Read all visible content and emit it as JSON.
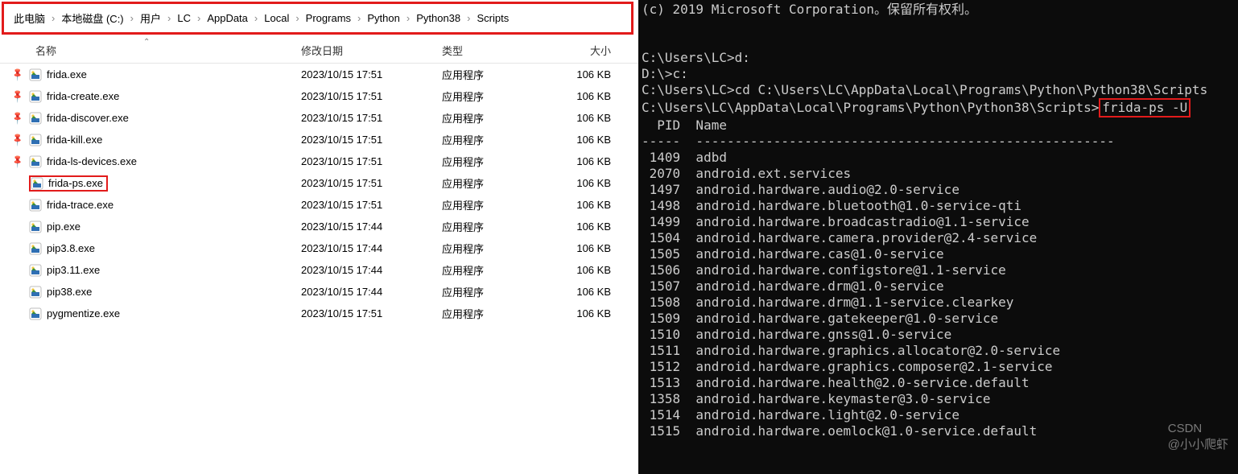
{
  "breadcrumb": [
    "此电脑",
    "本地磁盘 (C:)",
    "用户",
    "LC",
    "AppData",
    "Local",
    "Programs",
    "Python",
    "Python38",
    "Scripts"
  ],
  "columns": {
    "name": "名称",
    "date": "修改日期",
    "type": "类型",
    "size": "大小"
  },
  "files": [
    {
      "pin": true,
      "name": "frida.exe",
      "date": "2023/10/15 17:51",
      "type": "应用程序",
      "size": "106 KB",
      "hl": false
    },
    {
      "pin": true,
      "name": "frida-create.exe",
      "date": "2023/10/15 17:51",
      "type": "应用程序",
      "size": "106 KB",
      "hl": false
    },
    {
      "pin": true,
      "name": "frida-discover.exe",
      "date": "2023/10/15 17:51",
      "type": "应用程序",
      "size": "106 KB",
      "hl": false
    },
    {
      "pin": true,
      "name": "frida-kill.exe",
      "date": "2023/10/15 17:51",
      "type": "应用程序",
      "size": "106 KB",
      "hl": false
    },
    {
      "pin": true,
      "name": "frida-ls-devices.exe",
      "date": "2023/10/15 17:51",
      "type": "应用程序",
      "size": "106 KB",
      "hl": false
    },
    {
      "pin": false,
      "name": "frida-ps.exe",
      "date": "2023/10/15 17:51",
      "type": "应用程序",
      "size": "106 KB",
      "hl": true
    },
    {
      "pin": false,
      "name": "frida-trace.exe",
      "date": "2023/10/15 17:51",
      "type": "应用程序",
      "size": "106 KB",
      "hl": false
    },
    {
      "pin": false,
      "name": "pip.exe",
      "date": "2023/10/15 17:44",
      "type": "应用程序",
      "size": "106 KB",
      "hl": false
    },
    {
      "pin": false,
      "name": "pip3.8.exe",
      "date": "2023/10/15 17:44",
      "type": "应用程序",
      "size": "106 KB",
      "hl": false
    },
    {
      "pin": false,
      "name": "pip3.11.exe",
      "date": "2023/10/15 17:44",
      "type": "应用程序",
      "size": "106 KB",
      "hl": false
    },
    {
      "pin": false,
      "name": "pip38.exe",
      "date": "2023/10/15 17:44",
      "type": "应用程序",
      "size": "106 KB",
      "hl": false
    },
    {
      "pin": false,
      "name": "pygmentize.exe",
      "date": "2023/10/15 17:51",
      "type": "应用程序",
      "size": "106 KB",
      "hl": false
    }
  ],
  "terminal": {
    "copyright": "(c) 2019 Microsoft Corporation。保留所有权利。",
    "lines_before": [
      "",
      "C:\\Users\\LC>d:",
      "",
      "D:\\>c:",
      "",
      "C:\\Users\\LC>cd C:\\Users\\LC\\AppData\\Local\\Programs\\Python\\Python38\\Scripts",
      ""
    ],
    "prompt_path": "C:\\Users\\LC\\AppData\\Local\\Programs\\Python\\Python38\\Scripts>",
    "command": "frida-ps -U",
    "header": "  PID  Name",
    "divider": "-----  ------------------------------------------------------",
    "processes": [
      {
        "pid": "1409",
        "name": "adbd"
      },
      {
        "pid": "2070",
        "name": "android.ext.services"
      },
      {
        "pid": "1497",
        "name": "android.hardware.audio@2.0-service"
      },
      {
        "pid": "1498",
        "name": "android.hardware.bluetooth@1.0-service-qti"
      },
      {
        "pid": "1499",
        "name": "android.hardware.broadcastradio@1.1-service"
      },
      {
        "pid": "1504",
        "name": "android.hardware.camera.provider@2.4-service"
      },
      {
        "pid": "1505",
        "name": "android.hardware.cas@1.0-service"
      },
      {
        "pid": "1506",
        "name": "android.hardware.configstore@1.1-service"
      },
      {
        "pid": "1507",
        "name": "android.hardware.drm@1.0-service"
      },
      {
        "pid": "1508",
        "name": "android.hardware.drm@1.1-service.clearkey"
      },
      {
        "pid": "1509",
        "name": "android.hardware.gatekeeper@1.0-service"
      },
      {
        "pid": "1510",
        "name": "android.hardware.gnss@1.0-service"
      },
      {
        "pid": "1511",
        "name": "android.hardware.graphics.allocator@2.0-service"
      },
      {
        "pid": "1512",
        "name": "android.hardware.graphics.composer@2.1-service"
      },
      {
        "pid": "1513",
        "name": "android.hardware.health@2.0-service.default"
      },
      {
        "pid": "1358",
        "name": "android.hardware.keymaster@3.0-service"
      },
      {
        "pid": "1514",
        "name": "android.hardware.light@2.0-service"
      },
      {
        "pid": "1515",
        "name": "android.hardware.oemlock@1.0-service.default"
      }
    ]
  },
  "watermark": {
    "brand": "CSDN",
    "author": "@小小爬虾"
  }
}
